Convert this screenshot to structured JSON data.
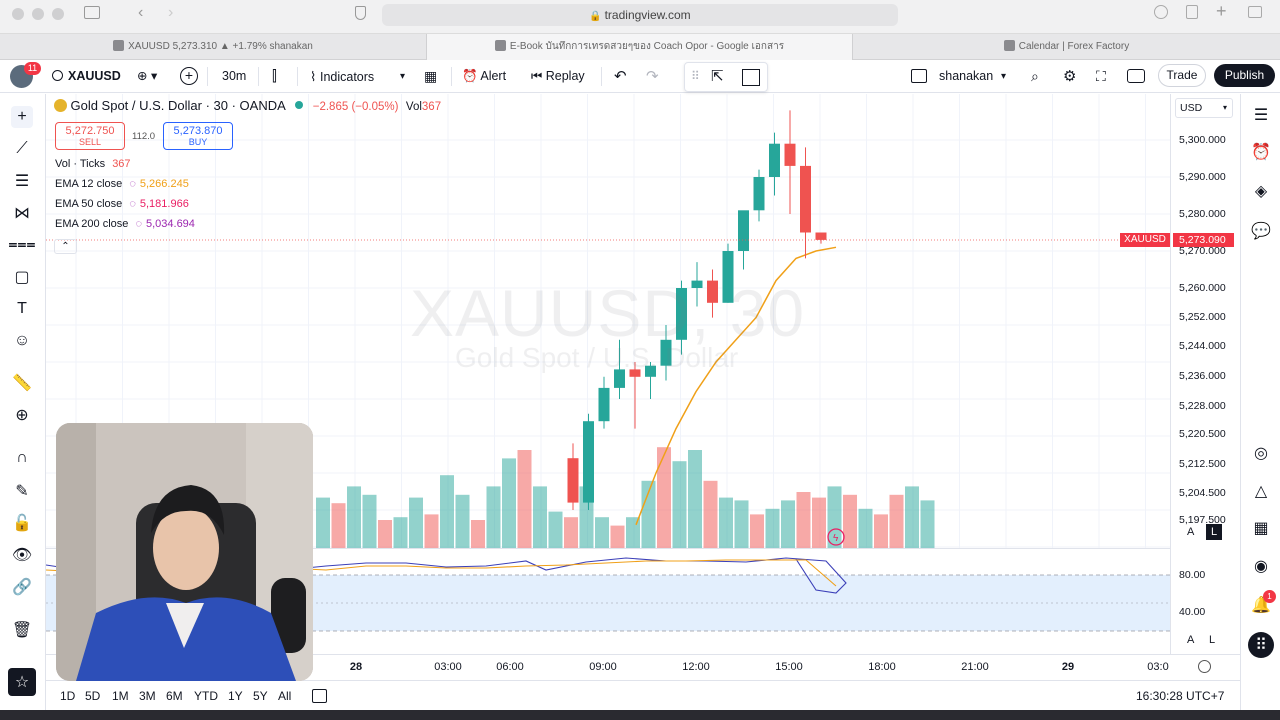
{
  "browser": {
    "url": "tradingview.com",
    "tabs": [
      {
        "label": "XAUUSD 5,273.310 ▲ +1.79% shanakan",
        "active": false
      },
      {
        "label": "E-Book บันทึกการเทรดสวยๆของ Coach Opor - Google เอกสาร",
        "active": true
      },
      {
        "label": "Calendar | Forex Factory",
        "active": false
      }
    ]
  },
  "toolbar": {
    "notif_badge": "11",
    "symbol": "XAUUSD",
    "interval": "30m",
    "indicators_label": "Indicators",
    "alert_label": "Alert",
    "replay_label": "Replay",
    "layout_name": "shanakan",
    "trade_label": "Trade",
    "publish_label": "Publish"
  },
  "legend": {
    "title": "Gold Spot / U.S. Dollar · 30 · OANDA",
    "change": "−2.865 (−0.05%)",
    "vol_label": "Vol",
    "vol_value": "367",
    "sell_price": "5,272.750",
    "sell_label": "SELL",
    "spread": "112.0",
    "buy_price": "5,273.870",
    "buy_label": "BUY",
    "indicators": [
      {
        "name": "Vol · Ticks",
        "value": "367",
        "color": "#e91e63"
      },
      {
        "name": "EMA 12 close",
        "value": "5,266.245",
        "color": "#f0a018"
      },
      {
        "name": "EMA 50 close",
        "value": "5,181.966",
        "color": "#e91e63"
      },
      {
        "name": "EMA 200 close",
        "value": "5,034.694",
        "color": "#9c27b0"
      }
    ]
  },
  "watermark": {
    "line1": "XAUUSD, 30",
    "line2": "Gold Spot / U.S. Dollar"
  },
  "price_axis": {
    "currency": "USD",
    "labels": [
      "5,300.000",
      "5,290.000",
      "5,280.000",
      "5,270.000",
      "5,260.000",
      "5,252.000",
      "5,244.000",
      "5,236.000",
      "5,228.000",
      "5,220.500",
      "5,212.500",
      "5,204.500",
      "5,197.500"
    ],
    "last_symbol": "XAUUSD",
    "last_price": "5,273.090",
    "mode_a": "A",
    "mode_l": "L"
  },
  "rsi_axis": {
    "labels": [
      "80.00",
      "40.00"
    ]
  },
  "time_axis": {
    "labels": [
      "28",
      "03:00",
      "06:00",
      "09:00",
      "12:00",
      "15:00",
      "18:00",
      "21:00",
      "29",
      "03:0"
    ]
  },
  "ranges": [
    "1D",
    "5D",
    "1M",
    "3M",
    "6M",
    "YTD",
    "1Y",
    "5Y",
    "All"
  ],
  "clock": "16:30:28 UTC+7",
  "right_badge": "1",
  "colors": {
    "up": "#26a69a",
    "down": "#ef5350",
    "ema": "#f0a018",
    "accent": "#2962ff"
  },
  "chart_data": {
    "type": "candlestick",
    "candles": [
      [
        5214,
        5218,
        5200,
        5202
      ],
      [
        5202,
        5226,
        5200,
        5224
      ],
      [
        5224,
        5236,
        5222,
        5233
      ],
      [
        5233,
        5246,
        5230,
        5238
      ],
      [
        5238,
        5240,
        5222,
        5236
      ],
      [
        5236,
        5240,
        5230,
        5239
      ],
      [
        5239,
        5250,
        5235,
        5246
      ],
      [
        5246,
        5262,
        5242,
        5260
      ],
      [
        5260,
        5267,
        5255,
        5262
      ],
      [
        5262,
        5265,
        5252,
        5256
      ],
      [
        5256,
        5272,
        5256,
        5270
      ],
      [
        5270,
        5280,
        5265,
        5281
      ],
      [
        5281,
        5292,
        5278,
        5290
      ],
      [
        5290,
        5302,
        5285,
        5299
      ],
      [
        5299,
        5308,
        5280,
        5293
      ],
      [
        5293,
        5298,
        5268,
        5275
      ],
      [
        5275,
        5275,
        5272,
        5273
      ]
    ],
    "ema12": [
      5196,
      5210,
      5222,
      5232,
      5240,
      5246,
      5252,
      5262,
      5268,
      5270,
      5271
    ],
    "volume": [
      18,
      16,
      22,
      19,
      10,
      11,
      18,
      12,
      26,
      19,
      10,
      22,
      32,
      35,
      22,
      13,
      11,
      22,
      11,
      8,
      11,
      24,
      36,
      31,
      35,
      24,
      18,
      17,
      12,
      14,
      17,
      20,
      18,
      22,
      19,
      14,
      12,
      19,
      22,
      17
    ]
  }
}
